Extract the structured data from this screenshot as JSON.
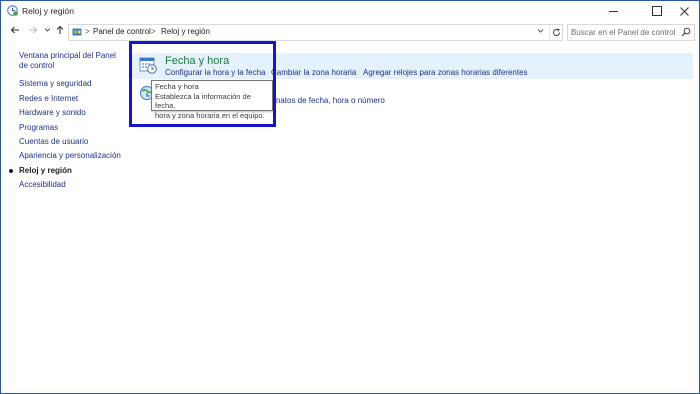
{
  "window": {
    "title": "Reloj y región"
  },
  "address": {
    "breadcrumbs": [
      "Panel de control",
      "Reloj y región"
    ],
    "separator": ">",
    "search_placeholder": "Buscar en el Panel de control"
  },
  "sidebar": {
    "items": [
      {
        "label": "Ventana principal del Panel de control",
        "current": false
      },
      {
        "label": "Sistema y seguridad",
        "current": false
      },
      {
        "label": "Redes e Internet",
        "current": false
      },
      {
        "label": "Hardware y sonido",
        "current": false
      },
      {
        "label": "Programas",
        "current": false
      },
      {
        "label": "Cuentas de usuario",
        "current": false
      },
      {
        "label": "Apariencia y personalización",
        "current": false
      },
      {
        "label": "Reloj y región",
        "current": true
      },
      {
        "label": "Accesibilidad",
        "current": false
      }
    ]
  },
  "content": {
    "date_time": {
      "title": "Fecha y hora",
      "links": [
        "Configurar la hora y la fecha",
        "Cambiar la zona horaria",
        "Agregar relojes para zonas horarias diferentes"
      ]
    },
    "region": {
      "link": "rmatos de fecha, hora o número"
    },
    "tooltip": {
      "line1": "Fecha y hora",
      "line2": "Establezca la información de fecha,",
      "line3": "hora y zona horaria en el equipo."
    }
  },
  "colors": {
    "link": "#1e3287",
    "category_title": "#1e7a3e",
    "highlight_bg": "#e5f1fb",
    "annotation_box": "#1414d2"
  }
}
